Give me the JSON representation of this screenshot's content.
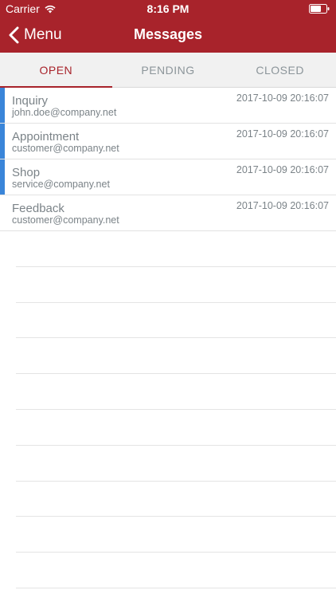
{
  "status_bar": {
    "carrier": "Carrier",
    "time": "8:16 PM"
  },
  "nav": {
    "back_label": "Menu",
    "title": "Messages"
  },
  "tabs": [
    {
      "label": "OPEN",
      "active": true
    },
    {
      "label": "PENDING",
      "active": false
    },
    {
      "label": "CLOSED",
      "active": false
    }
  ],
  "messages": [
    {
      "subject": "Inquiry",
      "sender": "john.doe@company.net",
      "time": "2017-10-09 20:16:07",
      "unread": true
    },
    {
      "subject": "Appointment",
      "sender": "customer@company.net",
      "time": "2017-10-09 20:16:07",
      "unread": true
    },
    {
      "subject": "Shop",
      "sender": "service@company.net",
      "time": "2017-10-09 20:16:07",
      "unread": true
    },
    {
      "subject": "Feedback",
      "sender": "customer@company.net",
      "time": "2017-10-09 20:16:07",
      "unread": false
    }
  ],
  "colors": {
    "brand": "#a8232b",
    "unread_indicator": "#3a85d9",
    "tab_bar": "#f1f1f1",
    "text_muted": "#7b8388"
  },
  "icons": {
    "wifi": "wifi-icon",
    "battery": "battery-icon",
    "back": "chevron-left-icon"
  }
}
